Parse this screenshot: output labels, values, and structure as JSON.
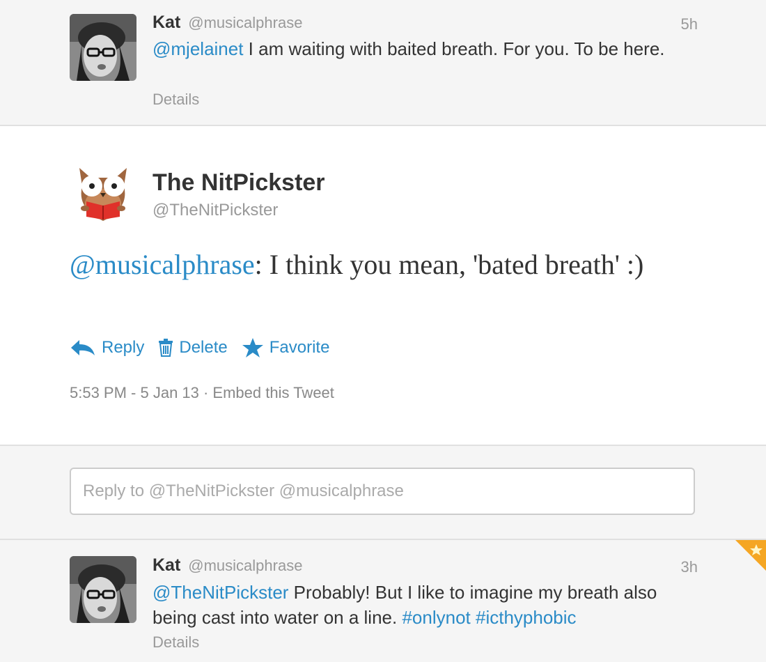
{
  "tweets": [
    {
      "name": "Kat",
      "handle": "@musicalphrase",
      "time": "5h",
      "mention": "@mjelainet",
      "text": " I am waiting with baited breath. For you. To be here.",
      "details": "Details"
    },
    {
      "name": "Kat",
      "handle": "@musicalphrase",
      "time": "3h",
      "mention": "@TheNitPickster",
      "text": " Probably! But I like to imagine my breath also being cast into water on a line. ",
      "hashtag1": "#onlynot",
      "hashtag2": "#icthyphobic",
      "details": "Details"
    }
  ],
  "focus": {
    "name": "The NitPickster",
    "handle": "@TheNitPickster",
    "mention": "@musicalphrase",
    "text": ": I think you mean, 'bated breath' :)",
    "actions": {
      "reply": "Reply",
      "delete": "Delete",
      "favorite": "Favorite"
    },
    "meta": "5:53 PM - 5 Jan 13 · Embed this Tweet"
  },
  "reply_box": {
    "placeholder": "Reply to @TheNitPickster @musicalphrase"
  },
  "colors": {
    "link": "#2a8bc7",
    "favorite_corner": "#f5a623"
  }
}
